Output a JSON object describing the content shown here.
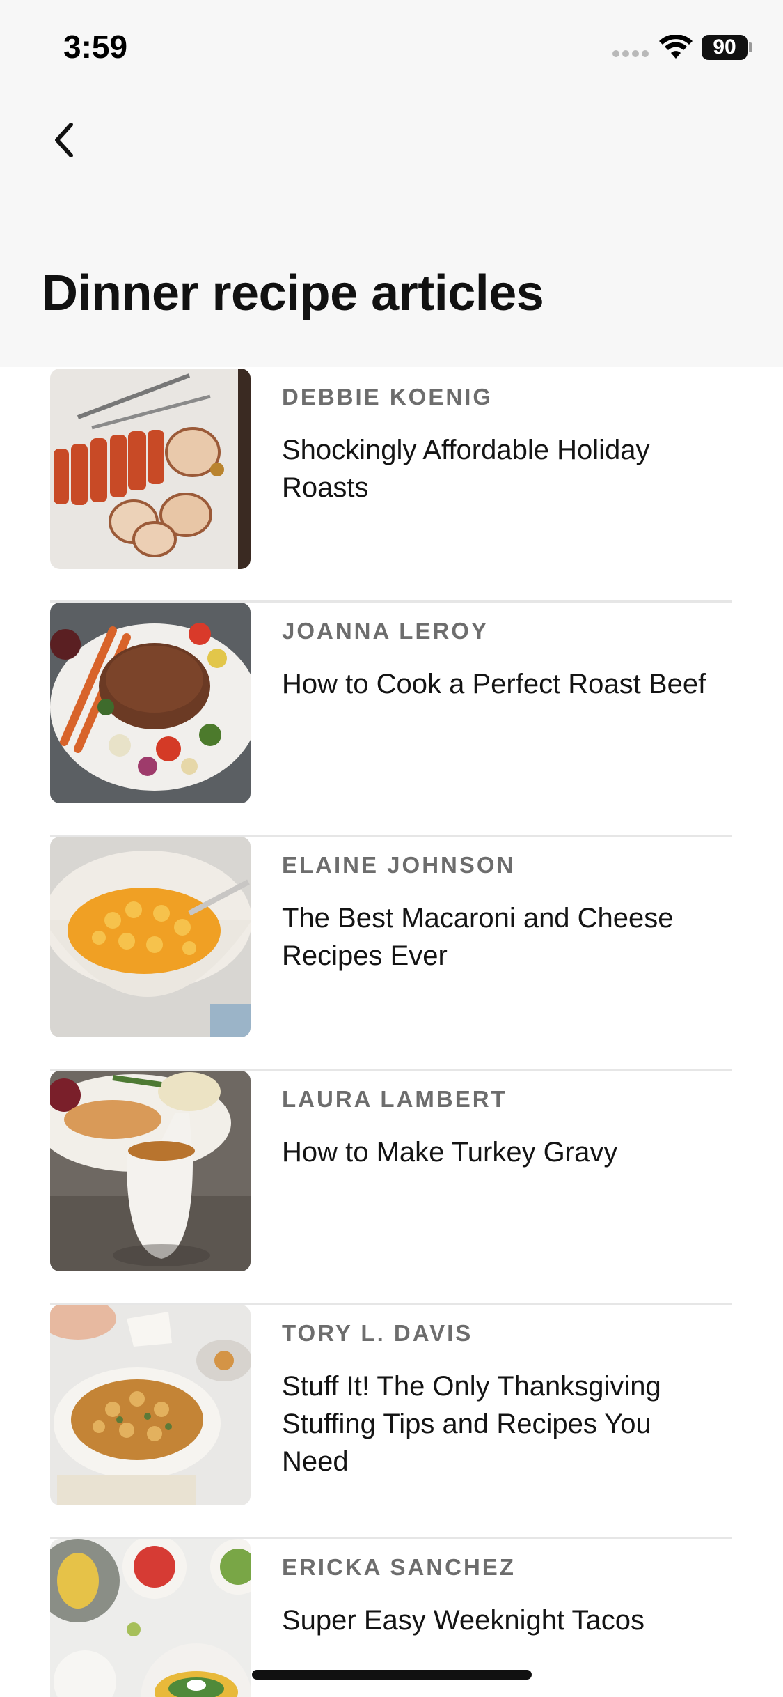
{
  "status_bar": {
    "time": "3:59",
    "battery": "90"
  },
  "header": {
    "title": "Dinner recipe articles",
    "back_icon": "chevron-left-icon"
  },
  "articles": [
    {
      "author": "DEBBIE KOENIG",
      "title": "Shockingly Affordable Holiday Roasts",
      "image": "sliced-pork-roast"
    },
    {
      "author": "JOANNA LEROY",
      "title": "How to Cook a Perfect Roast Beef",
      "image": "roast-beef-platter"
    },
    {
      "author": "ELAINE JOHNSON",
      "title": "The Best Macaroni and Cheese Recipes Ever",
      "image": "mac-and-cheese-bowl"
    },
    {
      "author": "LAURA LAMBERT",
      "title": "How to Make Turkey Gravy",
      "image": "gravy-boat"
    },
    {
      "author": "TORY L. DAVIS",
      "title": "Stuff It! The Only Thanksgiving Stuffing Tips and Recipes You Need",
      "image": "stuffing-bowl"
    },
    {
      "author": "ERICKA SANCHEZ",
      "title": "Super Easy Weeknight Tacos",
      "image": "taco-plates"
    }
  ]
}
